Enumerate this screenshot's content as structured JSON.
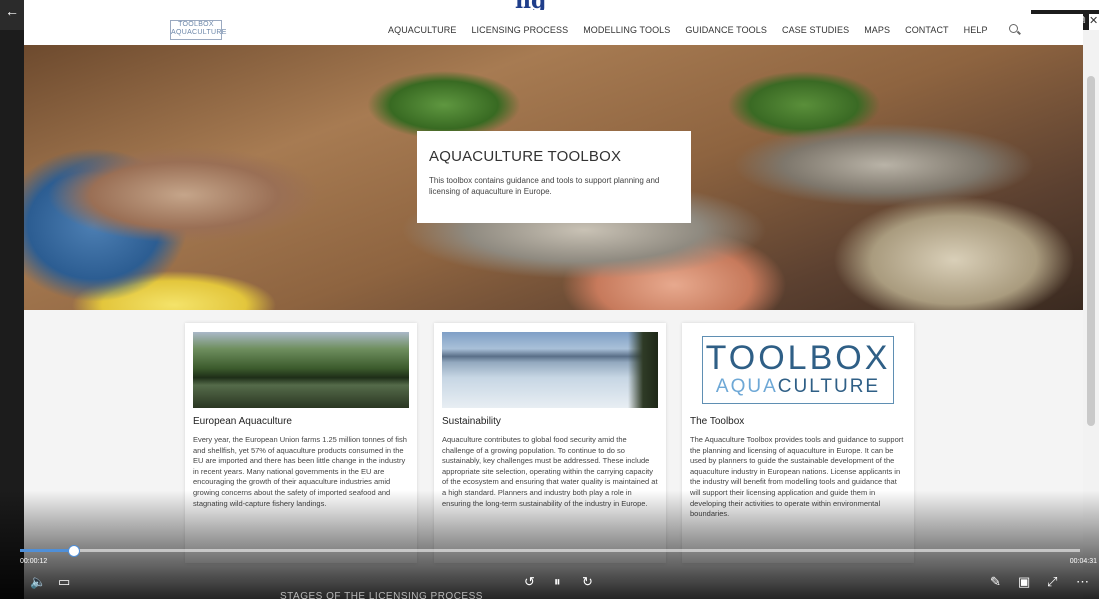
{
  "window": {
    "back_glyph": "←",
    "title_fragment": "ng",
    "minimize_glyph": "–",
    "restore_glyph": "⧉",
    "close_glyph": "✕"
  },
  "site": {
    "logo_line1": "TOOLBOX",
    "logo_line2": "AQUACULTURE",
    "nav": [
      "AQUACULTURE",
      "LICENSING PROCESS",
      "MODELLING TOOLS",
      "GUIDANCE TOOLS",
      "CASE STUDIES",
      "MAPS",
      "CONTACT",
      "HELP"
    ]
  },
  "hero": {
    "title": "AQUACULTURE TOOLBOX",
    "text": "This toolbox contains guidance and tools to support planning and licensing of aquaculture in Europe."
  },
  "cards": [
    {
      "title": "European Aquaculture",
      "text": "Every year, the European Union farms 1.25 million tonnes of fish and shellfish, yet 57% of aquaculture products consumed in the EU are imported and there has been little change in the industry in recent years. Many national governments in the EU are encouraging the growth of their aquaculture industries amid growing concerns about the safety of imported seafood and stagnating wild-capture fishery landings."
    },
    {
      "title": "Sustainability",
      "text": "Aquaculture contributes to global food security amid the challenge of a growing population. To continue to do so sustainably, key challenges must be addressed. These include appropriate site selection, operating within the carrying capacity of the ecosystem and ensuring that water quality is maintained at a high standard. Planners and industry both play a role in ensuring the long-term sustainability of the industry in Europe."
    },
    {
      "title": "The Toolbox",
      "logo_line1": "TOOLBOX",
      "logo_line2_a": "AQUA",
      "logo_line2_b": "CULTURE",
      "text": "The Aquaculture Toolbox provides tools and guidance to support the planning and licensing of aquaculture in Europe. It can be used by planners to guide the sustainable development of the aquaculture industry in European nations. License applicants in the industry will benefit from modelling tools and guidance that will support their licensing application and guide them in developing their activities to operate within environmental boundaries."
    }
  ],
  "player": {
    "elapsed": "00:00:12",
    "duration": "00:04:31",
    "progress_fraction": 0.05,
    "icons": {
      "volume": "🔈",
      "captions": "▭",
      "rewind": "↺",
      "pause": "⏸",
      "forward": "↻",
      "pen": "✎",
      "miniplayer": "▣",
      "fullscreen": "⤢",
      "more": "⋯"
    }
  },
  "below_text": "STAGES OF THE LICENSING PROCESS",
  "colors": {
    "accent": "#4f8fd8",
    "logo_blue": "#2f5f86"
  }
}
